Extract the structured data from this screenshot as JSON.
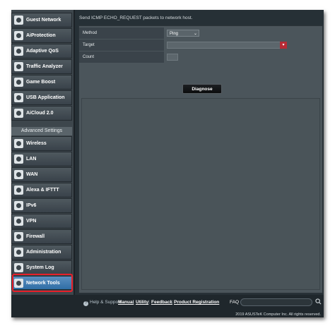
{
  "sidebar": {
    "items": [
      {
        "label": "Guest Network",
        "icon": "guest-network-icon"
      },
      {
        "label": "AiProtection",
        "icon": "aiprotection-icon"
      },
      {
        "label": "Adaptive QoS",
        "icon": "adaptive-qos-icon"
      },
      {
        "label": "Traffic Analyzer",
        "icon": "traffic-analyzer-icon"
      },
      {
        "label": "Game Boost",
        "icon": "game-boost-icon"
      },
      {
        "label": "USB Application",
        "icon": "usb-icon"
      },
      {
        "label": "AiCloud 2.0",
        "icon": "cloud-icon"
      }
    ],
    "advanced_header": "Advanced Settings",
    "advanced_items": [
      {
        "label": "Wireless",
        "icon": "wireless-icon"
      },
      {
        "label": "LAN",
        "icon": "lan-icon"
      },
      {
        "label": "WAN",
        "icon": "wan-icon"
      },
      {
        "label": "Alexa & IFTTT",
        "icon": "alexa-icon"
      },
      {
        "label": "IPv6",
        "icon": "ipv6-icon"
      },
      {
        "label": "VPN",
        "icon": "vpn-icon"
      },
      {
        "label": "Firewall",
        "icon": "firewall-icon"
      },
      {
        "label": "Administration",
        "icon": "administration-icon"
      },
      {
        "label": "System Log",
        "icon": "system-log-icon"
      },
      {
        "label": "Network Tools",
        "icon": "network-tools-icon",
        "active": true
      }
    ]
  },
  "main": {
    "description": "Send ICMP ECHO_REQUEST packets to network host.",
    "method_label": "Method",
    "method_value": "Ping",
    "target_label": "Target",
    "target_value": "",
    "count_label": "Count",
    "count_value": "",
    "diagnose_label": "Diagnose",
    "output": ""
  },
  "footer": {
    "help_label": "Help & Support",
    "links": [
      "Manual",
      "Utility",
      "Feedback",
      "Product Registration"
    ],
    "faq_label": "FAQ",
    "search_value": "",
    "copyright": "2019 ASUSTeK Computer Inc. All rights reserved."
  },
  "colors": {
    "background": "#263036",
    "sidebar": "#3d464c",
    "active_item": "#2f6ea6",
    "highlight": "#e8202a",
    "dropdown_accent": "#b62b36"
  }
}
